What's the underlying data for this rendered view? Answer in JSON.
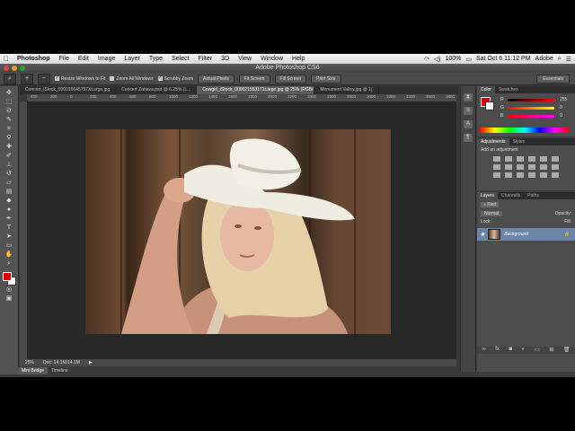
{
  "menubar": {
    "app": "Photoshop",
    "items": [
      "File",
      "Edit",
      "Image",
      "Layer",
      "Type",
      "Select",
      "Filter",
      "3D",
      "View",
      "Window",
      "Help"
    ],
    "battery": "100%",
    "datetime": "Sat Oct 6  11:12 PM",
    "user": "Adobe"
  },
  "window": {
    "title": "Adobe Photoshop CS6"
  },
  "options": {
    "resize_windows": "Resize Windows to Fit",
    "zoom_all": "Zoom All Windows",
    "scrubby_zoom": "Scrubby Zoom",
    "actual_pixels": "Actual Pixels",
    "fit_screen": "Fit Screen",
    "fill_screen": "Fill Screen",
    "print_size": "Print Size",
    "workspace": "Essentials"
  },
  "tabs": [
    {
      "label": "Concert_iStock_000016645797XLarge.jpg"
    },
    {
      "label": "Concert Zahava.psd @ 6.25% (L..."
    },
    {
      "label": "Cowgirl_iStock_000021553171Large.jpg @ 25% (RGB/8*)"
    },
    {
      "label": "Monument Valley.jpg @ 1("
    }
  ],
  "ruler": [
    "400",
    "200",
    "0",
    "200",
    "400",
    "600",
    "800",
    "1000",
    "1200",
    "1400",
    "1600",
    "1800",
    "2000",
    "2200",
    "2400",
    "2600",
    "2800",
    "3000",
    "3200",
    "3400",
    "3600",
    "3800"
  ],
  "status": {
    "zoom": "25%",
    "doc": "Doc: 14.1M/14.1M"
  },
  "bottom_tabs": [
    "Mini Bridge",
    "Timeline"
  ],
  "panels": {
    "color_tabs": [
      "Color",
      "Swatches"
    ],
    "sliders": [
      {
        "label": "R",
        "value": "255"
      },
      {
        "label": "G",
        "value": "0"
      },
      {
        "label": "B",
        "value": "0"
      }
    ],
    "adjustments_tabs": [
      "Adjustments",
      "Styles"
    ],
    "add_adjustment": "Add an adjustment",
    "layers_tabs": [
      "Layers",
      "Channels",
      "Paths"
    ],
    "blend_mode": "Normal",
    "opacity_label": "Opacity:",
    "lock_label": "Lock:",
    "fill_label": "Fill:",
    "layer_name": "Background"
  },
  "colors": {
    "foreground": "#dd0000",
    "background": "#ffffff",
    "selected_layer": "#6a85a8"
  }
}
